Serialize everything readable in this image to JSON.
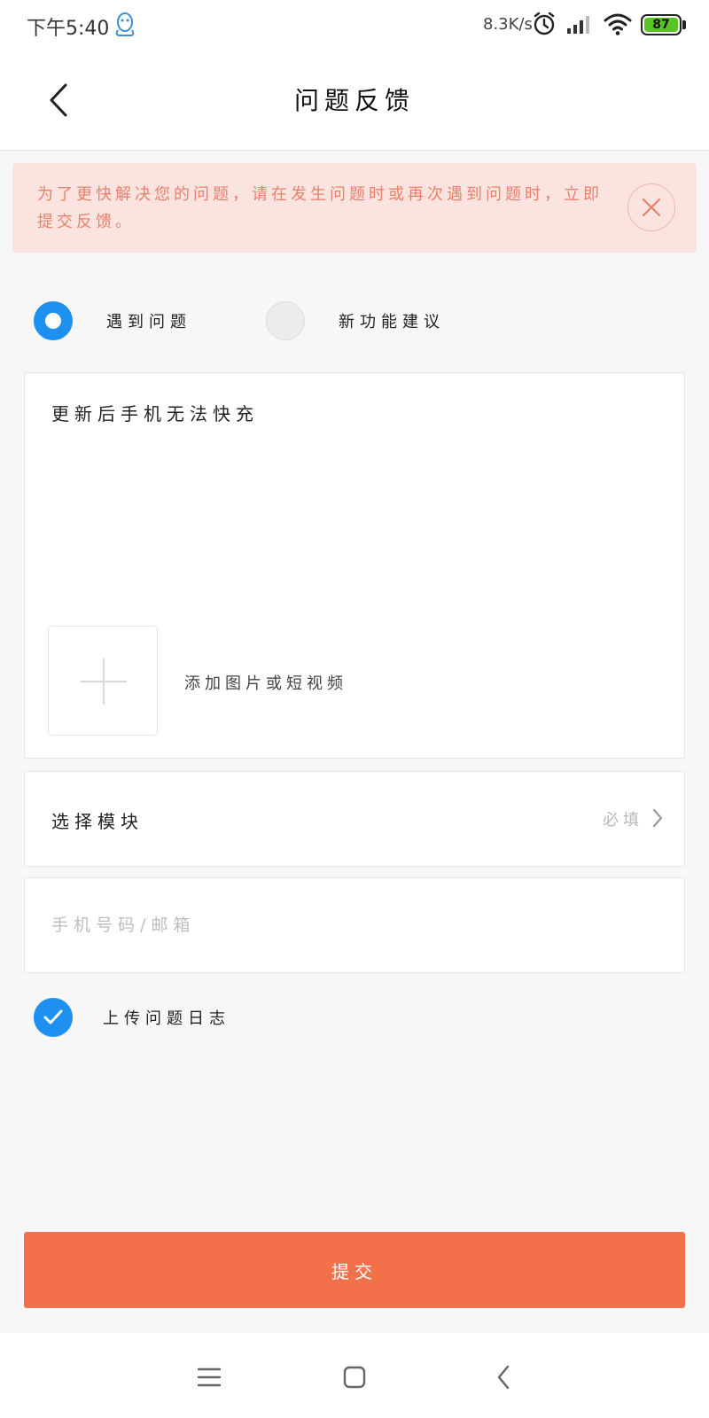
{
  "status_bar": {
    "time": "下午5:40",
    "net_speed": "8.3K/s",
    "battery_level": "87",
    "icons": [
      "qq-icon",
      "alarm-icon",
      "signal-icon",
      "wifi-icon",
      "battery-icon"
    ]
  },
  "header": {
    "title": "问题反馈",
    "back_icon": "chevron-left-icon"
  },
  "notice": {
    "text": "为了更快解决您的问题，请在发生问题时或再次遇到问题时，立即提交反馈。",
    "close_icon": "close-icon"
  },
  "feedback_type": {
    "options": [
      {
        "label": "遇到问题",
        "selected": true
      },
      {
        "label": "新功能建议",
        "selected": false
      }
    ]
  },
  "feedback": {
    "text": "更新后手机无法快充",
    "add_media_label": "添加图片或短视频",
    "add_icon": "plus-icon"
  },
  "module": {
    "label": "选择模块",
    "required": "必填"
  },
  "contact": {
    "placeholder": "手机号码/邮箱",
    "value": ""
  },
  "upload_log": {
    "label": "上传问题日志",
    "checked": true
  },
  "submit_label": "提交",
  "nav": {
    "icons": [
      "menu-icon",
      "home-icon",
      "back-icon"
    ]
  },
  "colors": {
    "accent_blue": "#1e90f0",
    "submit_orange": "#f2714a",
    "notice_bg": "#fbe4df",
    "notice_text": "#e9806c",
    "battery_green": "#58c322"
  }
}
